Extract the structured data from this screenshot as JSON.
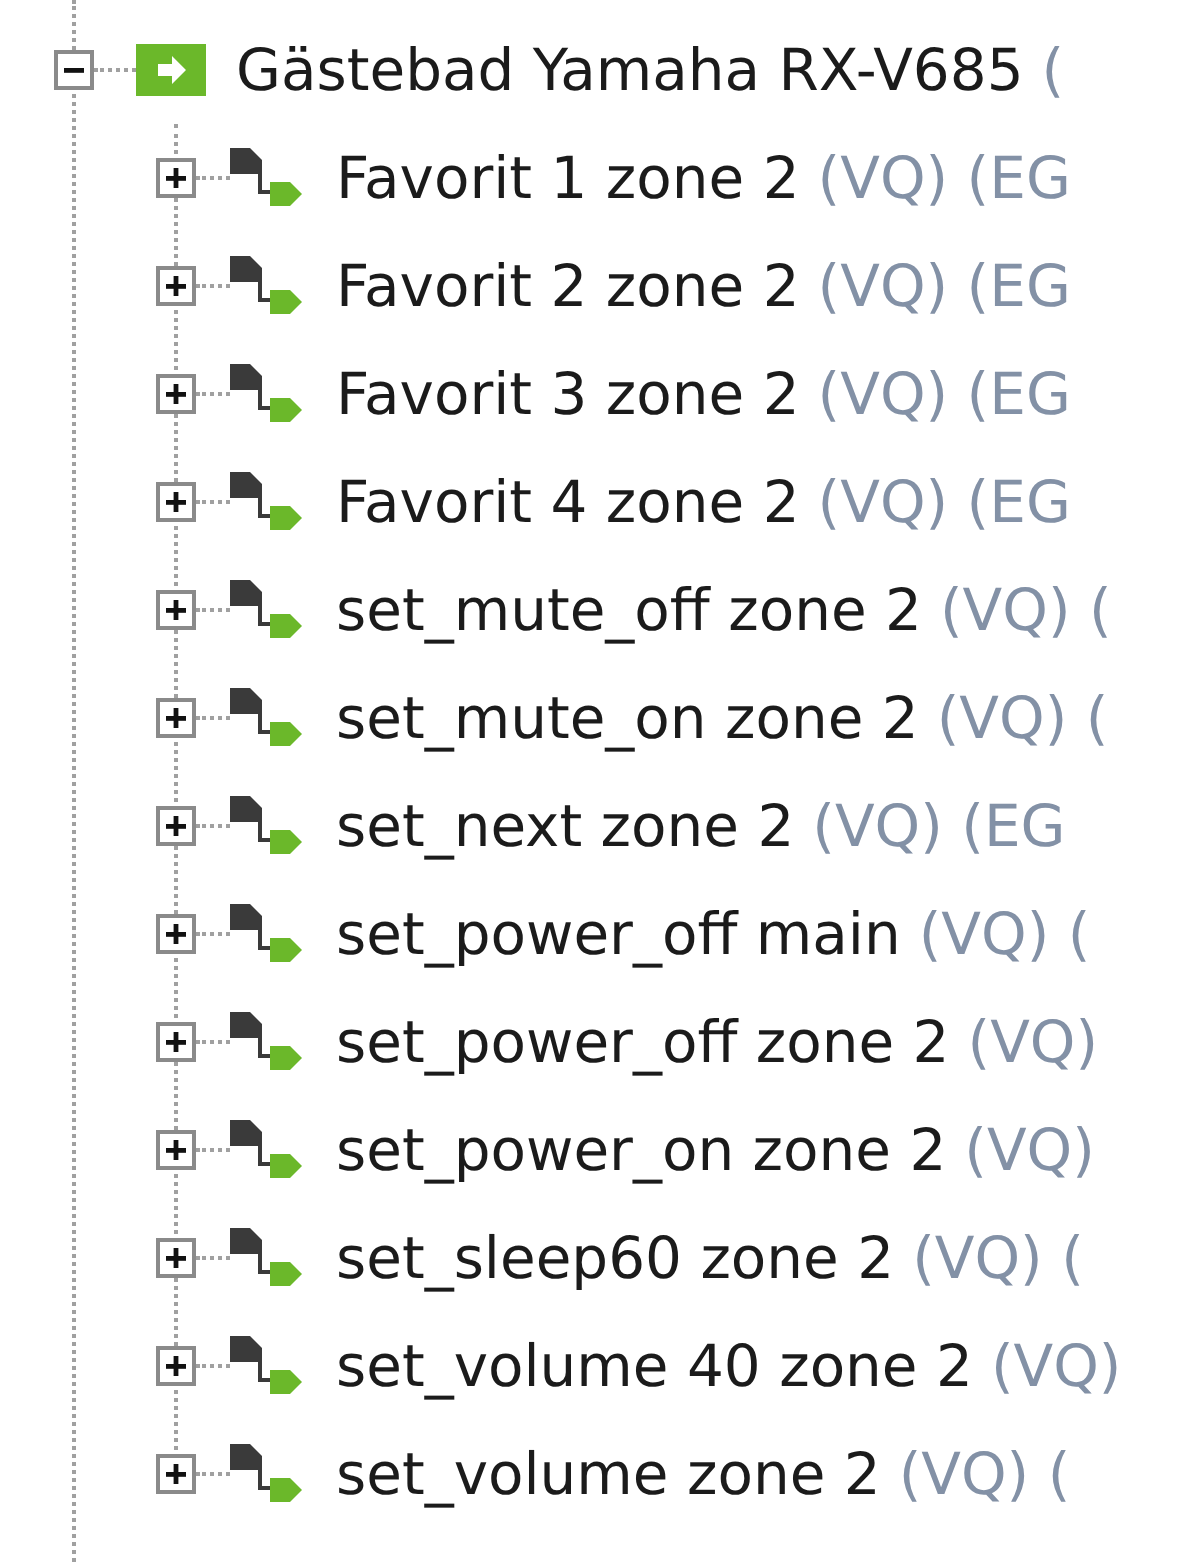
{
  "tree": {
    "root": {
      "label": "Gästebad Yamaha RX-V685",
      "detail": "(",
      "expanded": true,
      "children": [
        {
          "label": "Favorit 1 zone 2",
          "detail": "(VQ) (EG",
          "expanded": false
        },
        {
          "label": "Favorit 2 zone 2",
          "detail": "(VQ) (EG",
          "expanded": false
        },
        {
          "label": "Favorit 3 zone 2",
          "detail": "(VQ) (EG",
          "expanded": false
        },
        {
          "label": "Favorit 4 zone 2",
          "detail": "(VQ) (EG",
          "expanded": false
        },
        {
          "label": "set_mute_off zone 2",
          "detail": "(VQ) (",
          "expanded": false
        },
        {
          "label": "set_mute_on zone 2",
          "detail": "(VQ) (",
          "expanded": false
        },
        {
          "label": "set_next zone 2",
          "detail": "(VQ) (EG",
          "expanded": false
        },
        {
          "label": "set_power_off main",
          "detail": "(VQ) (",
          "expanded": false
        },
        {
          "label": "set_power_off zone 2",
          "detail": "(VQ)",
          "expanded": false
        },
        {
          "label": "set_power_on zone 2",
          "detail": "(VQ)",
          "expanded": false
        },
        {
          "label": "set_sleep60 zone 2",
          "detail": "(VQ) (",
          "expanded": false
        },
        {
          "label": "set_volume 40 zone 2",
          "detail": "(VQ)",
          "expanded": false
        },
        {
          "label": "set_volume zone 2",
          "detail": "(VQ) (",
          "expanded": false
        }
      ]
    }
  }
}
